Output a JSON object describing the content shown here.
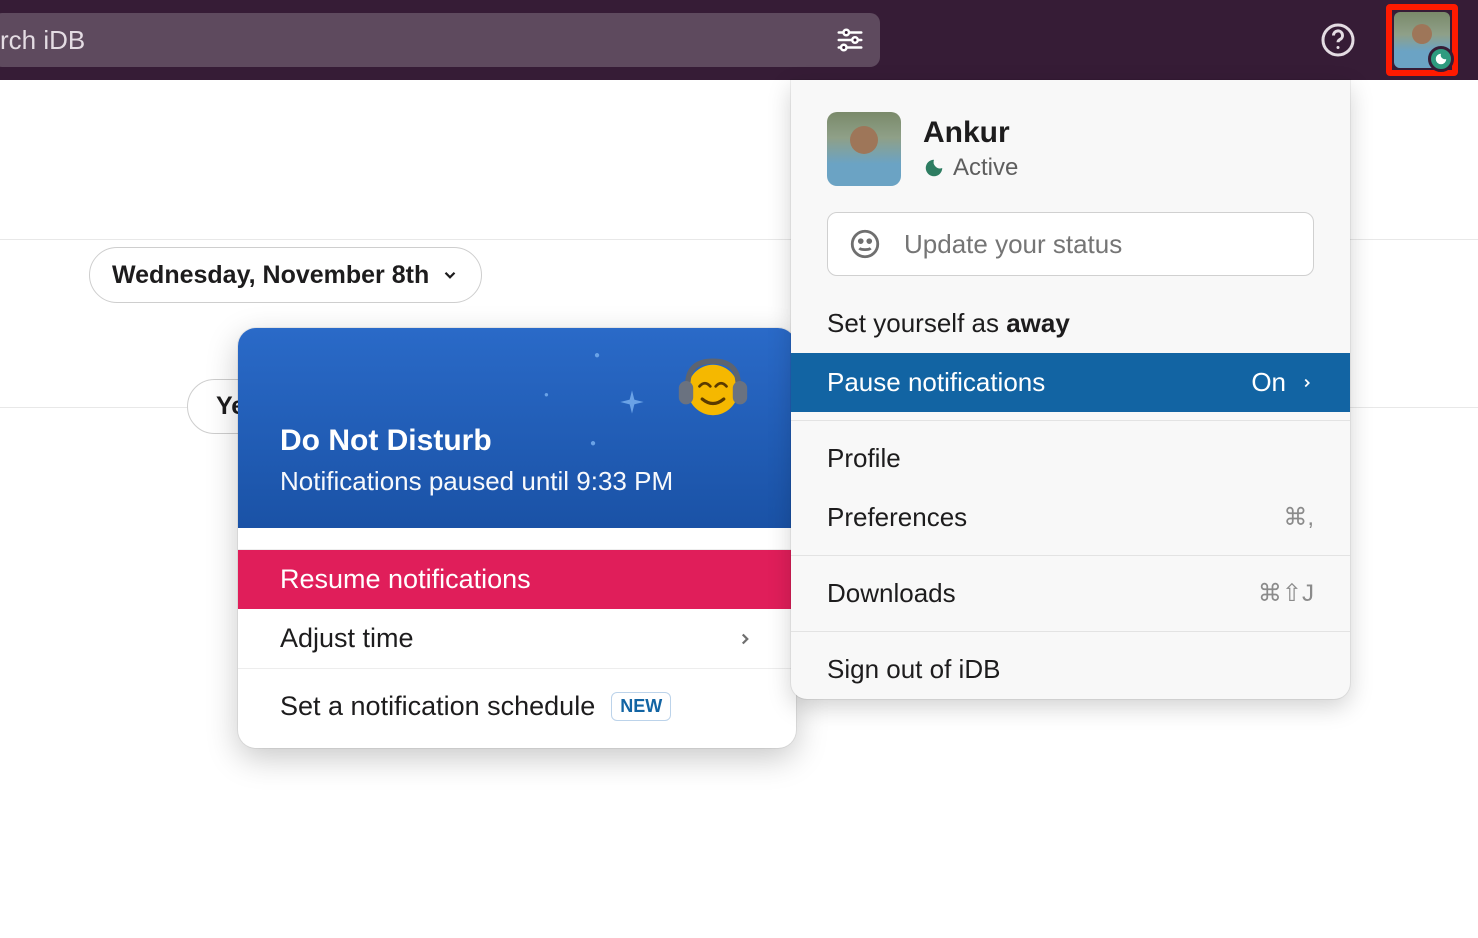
{
  "search": {
    "placeholder": "rch iDB"
  },
  "date_chip": "Wednesday, November 8th",
  "ye_chip": "Ye",
  "dnd": {
    "title": "Do Not Disturb",
    "subtitle": "Notifications paused until 9:33 PM",
    "resume": "Resume notifications",
    "adjust": "Adjust time",
    "schedule": "Set a notification schedule",
    "new_badge": "NEW"
  },
  "user_menu": {
    "name": "Ankur",
    "status": "Active",
    "update_placeholder": "Update your status",
    "away_prefix": "Set yourself as ",
    "away_bold": "away",
    "pause": "Pause notifications",
    "pause_state": "On",
    "profile": "Profile",
    "preferences": "Preferences",
    "preferences_shortcut": "⌘,",
    "downloads": "Downloads",
    "downloads_shortcut": "⌘⇧J",
    "signout": "Sign out of iDB"
  }
}
